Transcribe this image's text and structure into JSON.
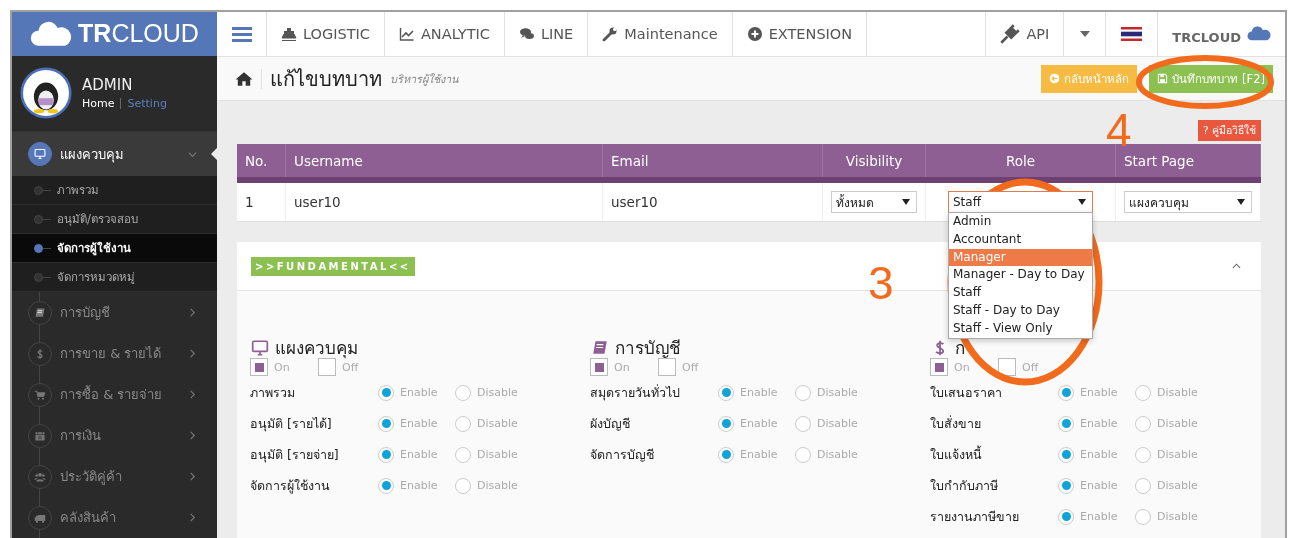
{
  "logo": {
    "text": "**TR**CLOUD"
  },
  "user": {
    "name": "ADMIN",
    "links": [
      {
        "label": "Home",
        "selected": true
      },
      {
        "label": "Setting",
        "selected": false
      }
    ]
  },
  "sidebar": {
    "items": [
      {
        "label": "แผงควบคุม",
        "kind": "monitor",
        "expanded": true,
        "children": [
          {
            "label": "ภาพรวม",
            "selected": false
          },
          {
            "label": "อนุมัติ/ตรวจสอบ",
            "selected": false
          },
          {
            "label": "จัดการผู้ใช้งาน",
            "selected": true
          },
          {
            "label": "จัดการหมวดหมู่",
            "selected": false
          }
        ]
      },
      {
        "label": "การบัญชี",
        "kind": "book",
        "expanded": false
      },
      {
        "label": "การขาย & รายได้",
        "kind": "dollar",
        "expanded": false
      },
      {
        "label": "การซื้อ & รายจ่าย",
        "kind": "cart",
        "expanded": false
      },
      {
        "label": "การเงิน",
        "kind": "calendar",
        "expanded": false
      },
      {
        "label": "ประวัติคู่ค้า",
        "kind": "users",
        "expanded": false
      },
      {
        "label": "คลังสินค้า",
        "kind": "truck",
        "expanded": false
      }
    ]
  },
  "topnav": [
    {
      "label": "LOGISTIC",
      "kind": "ship"
    },
    {
      "label": "ANALYTIC",
      "kind": "chart"
    },
    {
      "label": "LINE",
      "kind": "chat"
    },
    {
      "label": "Maintenance",
      "kind": "wrench"
    },
    {
      "label": "EXTENSION",
      "kind": "plus"
    }
  ],
  "topright": {
    "api": "API",
    "account": "TRCLOUD"
  },
  "page": {
    "title": "แก้ไขบทบาท",
    "subtitle": "บริหารผู้ใช้งาน",
    "buttons": [
      {
        "label": "กลับหน้าหลัก",
        "kind": "back"
      },
      {
        "label": "บันทึกบทบาท [F2]",
        "kind": "save"
      }
    ],
    "help": "? คู่มือวิธีใช้"
  },
  "table": {
    "columns": [
      "No.",
      "Username",
      "Email",
      "Visibility",
      "Role",
      "Start Page"
    ],
    "rows": [
      {
        "no": "1",
        "username": "user10",
        "email": "user10",
        "visibility": "ทั้งหมด",
        "role": "Staff",
        "start_page": "แผงควบคุม"
      }
    ]
  },
  "role_dropdown": {
    "open": true,
    "options": [
      {
        "label": "Admin",
        "selected": false
      },
      {
        "label": "Accountant",
        "selected": false
      },
      {
        "label": "Manager",
        "selected": true
      },
      {
        "label": "Manager - Day to Day",
        "selected": false
      },
      {
        "label": "Staff",
        "selected": false
      },
      {
        "label": "Staff - Day to Day",
        "selected": false
      },
      {
        "label": "Staff - View Only",
        "selected": false
      }
    ]
  },
  "panel": {
    "badge": ">>FUNDAMENTAL<<",
    "expanded": true,
    "sections": [
      {
        "title": "แผงควบคุม",
        "kind": "monitor",
        "on": true,
        "on_label": "On",
        "off_label": "Off",
        "permissions": [
          {
            "label": "ภาพรวม",
            "enabled": true,
            "options": [
              "Enable",
              "Disable"
            ]
          },
          {
            "label": "อนุมัติ [รายได้]",
            "enabled": true,
            "options": [
              "Enable",
              "Disable"
            ]
          },
          {
            "label": "อนุมัติ [รายจ่าย]",
            "enabled": true,
            "options": [
              "Enable",
              "Disable"
            ]
          },
          {
            "label": "จัดการผู้ใช้งาน",
            "enabled": true,
            "options": [
              "Enable",
              "Disable"
            ]
          }
        ]
      },
      {
        "title": "การบัญชี",
        "kind": "book",
        "on": true,
        "on_label": "On",
        "off_label": "Off",
        "permissions": [
          {
            "label": "สมุดรายวันทั่วไป",
            "enabled": true,
            "options": [
              "Enable",
              "Disable"
            ]
          },
          {
            "label": "ผังบัญชี",
            "enabled": true,
            "options": [
              "Enable",
              "Disable"
            ]
          },
          {
            "label": "จัดการบัญชี",
            "enabled": true,
            "options": [
              "Enable",
              "Disable"
            ]
          }
        ]
      },
      {
        "title": "ก",
        "kind": "dollar",
        "on": true,
        "on_label": "On",
        "off_label": "Off",
        "permissions": [
          {
            "label": "ใบเสนอราคา",
            "enabled": true,
            "options": [
              "Enable",
              "Disable"
            ]
          },
          {
            "label": "ใบสั่งขาย",
            "enabled": true,
            "options": [
              "Enable",
              "Disable"
            ]
          },
          {
            "label": "ใบแจ้งหนี้",
            "enabled": true,
            "options": [
              "Enable",
              "Disable"
            ]
          },
          {
            "label": "ใบกำกับภาษี",
            "enabled": true,
            "options": [
              "Enable",
              "Disable"
            ]
          },
          {
            "label": "รายงานภาษีขาย",
            "enabled": true,
            "options": [
              "Enable",
              "Disable"
            ]
          }
        ]
      }
    ]
  },
  "annotations": [
    {
      "text": "3",
      "kind": "role"
    },
    {
      "text": "4",
      "kind": "save"
    }
  ]
}
